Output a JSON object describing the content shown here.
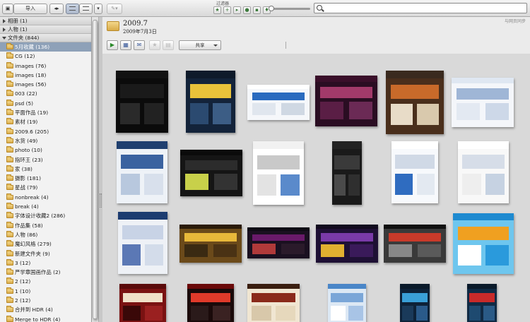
{
  "toolbar": {
    "import_label": "导入",
    "filter_label": "过滤器",
    "search_value": "",
    "icons": [
      "import-icon",
      "view-grid-icon",
      "view-list-icon",
      "view-dropdown-icon",
      "adjust-icon"
    ]
  },
  "sidebar": {
    "sections": [
      {
        "label": "相册 (1)",
        "expanded": false
      },
      {
        "label": "人物 (1)",
        "expanded": false
      },
      {
        "label": "文件夹 (844)",
        "expanded": true
      }
    ],
    "folders": [
      {
        "label": "5月收藏 (136)",
        "selected": true
      },
      {
        "label": "CG (12)"
      },
      {
        "label": "images (76)"
      },
      {
        "label": "images (18)"
      },
      {
        "label": "images (56)"
      },
      {
        "label": "003 (22)"
      },
      {
        "label": "psd (5)"
      },
      {
        "label": "平面作品 (19)"
      },
      {
        "label": "素材 (19)"
      },
      {
        "label": "2009.6 (205)"
      },
      {
        "label": "水货 (49)"
      },
      {
        "label": "photo (10)"
      },
      {
        "label": "指环王 (23)"
      },
      {
        "label": "家 (38)"
      },
      {
        "label": "摄影 (181)"
      },
      {
        "label": "星战 (79)"
      },
      {
        "label": "nonbreak (4)"
      },
      {
        "label": "break (4)"
      },
      {
        "label": "字体设计收藏2 (286)"
      },
      {
        "label": "作品集 (58)"
      },
      {
        "label": "人物 (86)"
      },
      {
        "label": "魔幻风格 (279)"
      },
      {
        "label": "新建文件夹 (9)"
      },
      {
        "label": "3 (12)"
      },
      {
        "label": "严学章国画作品 (2)"
      },
      {
        "label": "2 (12)"
      },
      {
        "label": "1 (10)"
      },
      {
        "label": "2 (12)"
      },
      {
        "label": "合并到 HDR (4)"
      },
      {
        "label": "Merge to HDR (4)"
      }
    ]
  },
  "main": {
    "folder_title": "2009.7",
    "folder_date": "2009年7月3日",
    "right_text": "与网页同步",
    "share_label": "共享",
    "thumbnails": [
      {
        "name": "thumb-1",
        "header": "#111111",
        "bg": "#0b0b0b",
        "a": "#1a1a1a",
        "b": "#2a2a2a",
        "c": "#222222"
      },
      {
        "name": "thumb-2",
        "header": "#0e1a2a",
        "bg": "#13233a",
        "a": "#e8c23a",
        "b": "#2b4a70",
        "c": "#3c5d85"
      },
      {
        "name": "thumb-3",
        "header": "#ffffff",
        "bg": "#f5f7fa",
        "a": "#2a6bbf",
        "b": "#e0e6ee",
        "c": "#cfd8e3"
      },
      {
        "name": "thumb-4",
        "header": "#3a0f2a",
        "bg": "#2a0d22",
        "a": "#a23a6a",
        "b": "#5a1e45",
        "c": "#6b2a55"
      },
      {
        "name": "thumb-5",
        "header": "#3a2a1e",
        "bg": "#4a2f1c",
        "a": "#c86a2a",
        "b": "#e8dcc8",
        "c": "#d9c9ad"
      },
      {
        "name": "thumb-6",
        "header": "#dfe7f2",
        "bg": "#f4f6fa",
        "a": "#9fb6d6",
        "b": "#e3e9f2",
        "c": "#cdd8e8"
      },
      {
        "name": "thumb-7",
        "header": "#1f3f6f",
        "bg": "#eef2f7",
        "a": "#3a62a0",
        "b": "#b8c8de",
        "c": "#d8e0ec"
      },
      {
        "name": "thumb-8",
        "header": "#0b0b0b",
        "bg": "#151515",
        "a": "#2c2c2c",
        "b": "#c8d04a",
        "c": "#333333"
      },
      {
        "name": "thumb-9",
        "header": "#f1f1f1",
        "bg": "#ffffff",
        "a": "#c9c9c9",
        "b": "#e3e3e3",
        "c": "#5a8acb"
      },
      {
        "name": "thumb-10",
        "header": "#222222",
        "bg": "#1a1a1a",
        "a": "#3a3a3a",
        "b": "#4a4a4a",
        "c": "#2f2f2f"
      },
      {
        "name": "thumb-11",
        "header": "#ffffff",
        "bg": "#f7f9fc",
        "a": "#d0d9e6",
        "b": "#2f6cc0",
        "c": "#e3e9f1"
      },
      {
        "name": "thumb-12",
        "header": "#ffffff",
        "bg": "#f8f8f8",
        "a": "#d6dde8",
        "b": "#eeeeee",
        "c": "#c6d2e2"
      },
      {
        "name": "thumb-13",
        "header": "#1c3c70",
        "bg": "#eef1f6",
        "a": "#c8d3e6",
        "b": "#5b78b5",
        "c": "#d3dcea"
      },
      {
        "name": "thumb-14",
        "header": "#2a1a08",
        "bg": "#6b4a1a",
        "a": "#e8b83a",
        "b": "#3a2a12",
        "c": "#4a3214"
      },
      {
        "name": "thumb-15",
        "header": "#0e0a14",
        "bg": "#1a1020",
        "a": "#6a1a6a",
        "b": "#b03a3a",
        "c": "#2a1a2a"
      },
      {
        "name": "thumb-16",
        "header": "#120a1e",
        "bg": "#1e1034",
        "a": "#7a3aa8",
        "b": "#e0b030",
        "c": "#3a1a5a"
      },
      {
        "name": "thumb-17",
        "header": "#101010",
        "bg": "#3a3a3a",
        "a": "#c83a2a",
        "b": "#888888",
        "c": "#5a5a5a"
      },
      {
        "name": "thumb-18",
        "header": "#1e8ad0",
        "bg": "#6ec6ee",
        "a": "#f0a020",
        "b": "#ffffff",
        "c": "#2a9adc"
      },
      {
        "name": "thumb-19",
        "header": "#5a0a0a",
        "bg": "#7a1212",
        "a": "#f0e0c8",
        "b": "#3a0808",
        "c": "#9a2020"
      },
      {
        "name": "thumb-20",
        "header": "#6a0a0a",
        "bg": "#1a0a0a",
        "a": "#e03a2a",
        "b": "#2a1a1a",
        "c": "#3a2222"
      },
      {
        "name": "thumb-21",
        "header": "#3a1e10",
        "bg": "#f0e6d2",
        "a": "#8a2a1a",
        "b": "#d8c8aa",
        "c": "#e6d8bc"
      },
      {
        "name": "thumb-22",
        "header": "#4a86c8",
        "bg": "#dce8f4",
        "a": "#7aa6d8",
        "b": "#ffffff",
        "c": "#a8c4e6"
      },
      {
        "name": "thumb-23",
        "header": "#0a1a2a",
        "bg": "#0e2238",
        "a": "#3aa0d8",
        "b": "#1a3a5a",
        "c": "#2a5a8a"
      },
      {
        "name": "thumb-24",
        "header": "#0a1a2a",
        "bg": "#102a44",
        "a": "#c82a2a",
        "b": "#1e4a70",
        "c": "#2a5a86"
      }
    ]
  }
}
